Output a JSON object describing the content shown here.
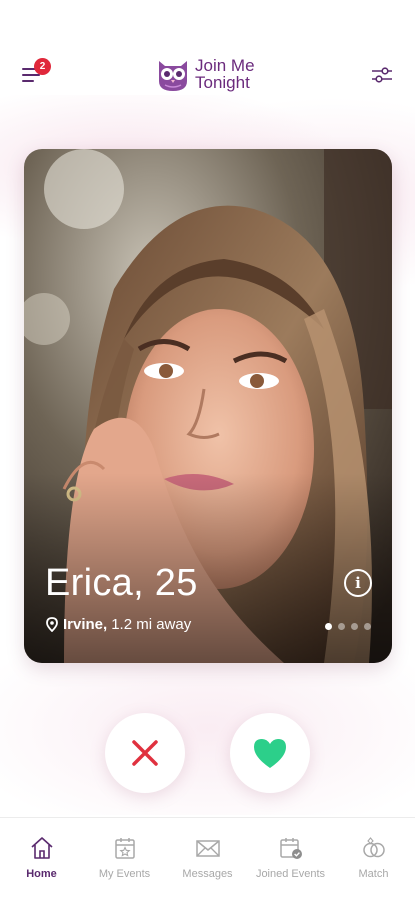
{
  "header": {
    "notification_count": "2",
    "logo_line1": "Join Me",
    "logo_line2": "Tonight",
    "menu_icon": "hamburger-icon",
    "filter_icon": "sliders-icon"
  },
  "card": {
    "name_age": "Erica, 25",
    "location_icon": "map-pin-icon",
    "city": "Irvine,",
    "distance": "1.2 mi away",
    "info_label": "i",
    "photo_count": 4,
    "active_photo_index": 0
  },
  "actions": {
    "dislike_icon": "x-icon",
    "like_icon": "heart-icon"
  },
  "nav": {
    "items": [
      {
        "label": "Home",
        "icon": "home-icon",
        "active": true
      },
      {
        "label": "My Events",
        "icon": "calendar-star-icon",
        "active": false
      },
      {
        "label": "Messages",
        "icon": "envelope-icon",
        "active": false
      },
      {
        "label": "Joined Events",
        "icon": "calendar-check-icon",
        "active": false
      },
      {
        "label": "Match",
        "icon": "rings-icon",
        "active": false
      }
    ]
  },
  "colors": {
    "brand": "#6b2b7d",
    "badge": "#e0283b",
    "dislike": "#e0313f",
    "like": "#2ccf8a",
    "nav_active": "#5a2a6e",
    "nav_inactive": "#a8a8a8"
  }
}
